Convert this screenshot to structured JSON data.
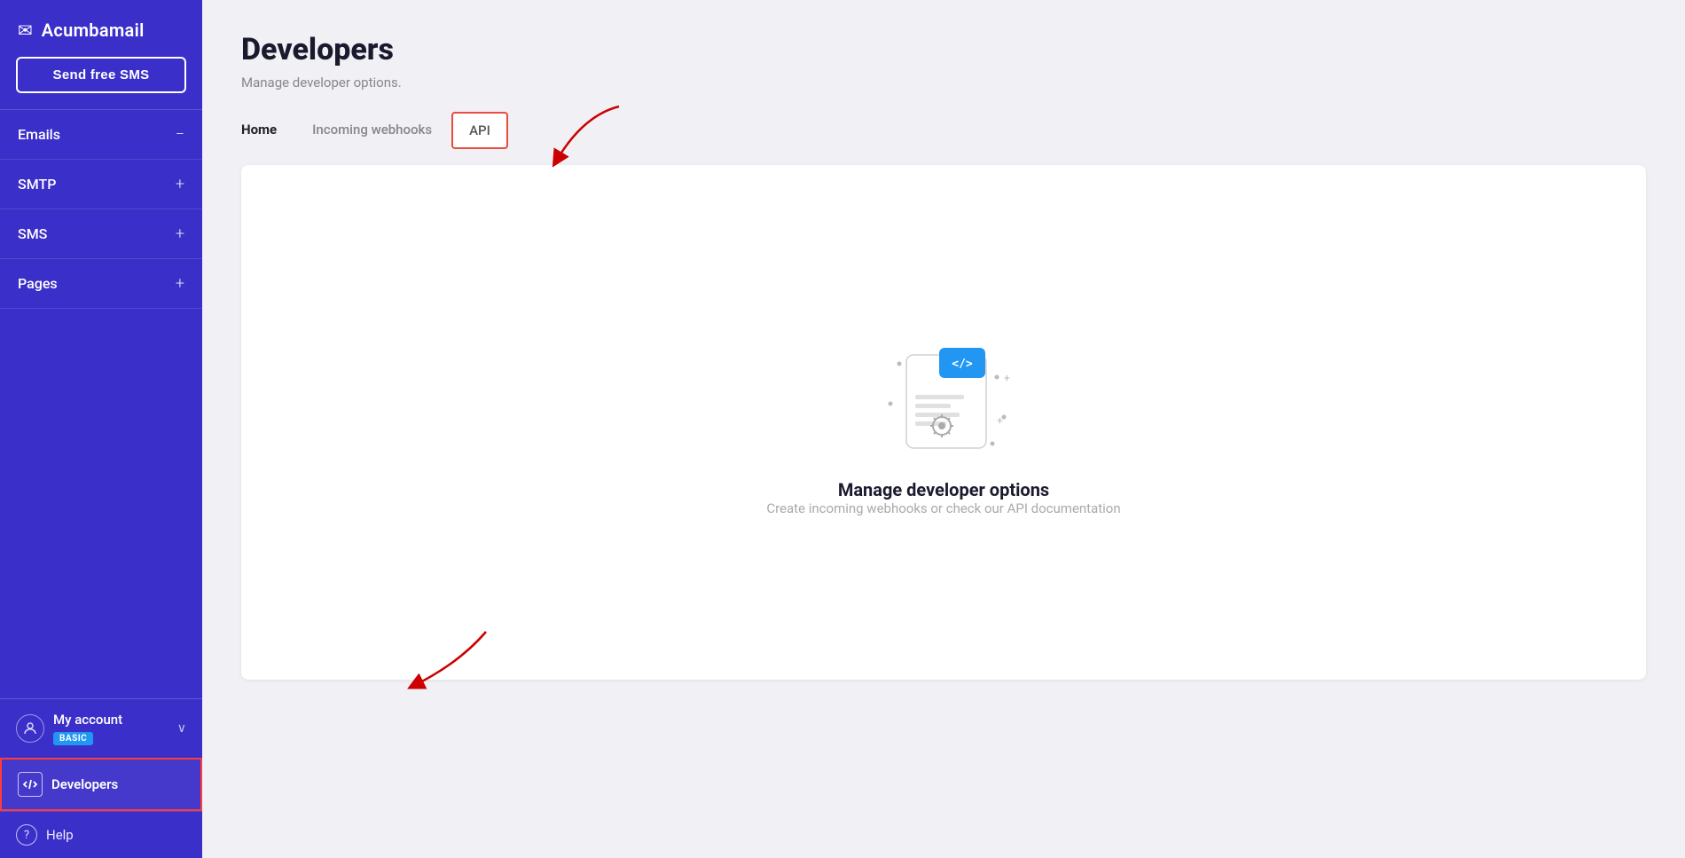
{
  "sidebar": {
    "logo_text": "Acumbamail",
    "send_sms_label": "Send free SMS",
    "nav_items": [
      {
        "label": "Emails",
        "icon": "−"
      },
      {
        "label": "SMTP",
        "icon": "+"
      },
      {
        "label": "SMS",
        "icon": "+"
      },
      {
        "label": "Pages",
        "icon": "+"
      }
    ],
    "account": {
      "name": "My account",
      "badge": "BASIC"
    },
    "developers_label": "Developers",
    "help_label": "Help"
  },
  "page": {
    "title": "Developers",
    "subtitle": "Manage developer options.",
    "tabs": [
      {
        "label": "Home",
        "active": true
      },
      {
        "label": "Incoming webhooks",
        "active": false
      },
      {
        "label": "API",
        "active": false,
        "highlighted": true
      }
    ],
    "content": {
      "title": "Manage developer options",
      "description": "Create incoming webhooks or check our API documentation"
    }
  },
  "colors": {
    "sidebar_bg": "#3b2fc9",
    "accent_blue": "#2196f3",
    "accent_red": "#e74c3c",
    "page_bg": "#f0f0f5"
  }
}
